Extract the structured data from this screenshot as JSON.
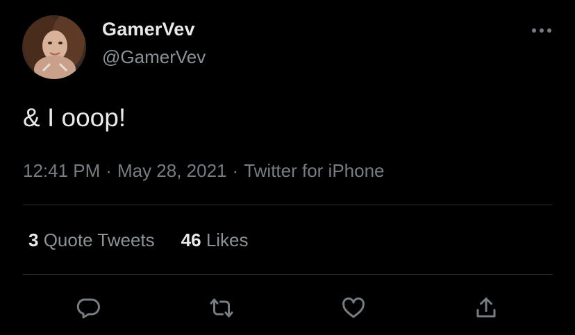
{
  "author": {
    "display_name": "GamerVev",
    "handle": "@GamerVev"
  },
  "tweet": {
    "text": "& I ooop!",
    "time": "12:41 PM",
    "date": "May 28, 2021",
    "source": "Twitter for iPhone",
    "separator": "·"
  },
  "stats": {
    "quote_tweets_count": "3",
    "quote_tweets_label": "Quote Tweets",
    "likes_count": "46",
    "likes_label": "Likes"
  },
  "icons": {
    "more": "more-horizontal-icon",
    "reply": "reply-bubble-icon",
    "retweet": "retweet-icon",
    "like": "heart-icon",
    "share": "share-icon"
  },
  "colors": {
    "background": "#000000",
    "primary_text": "#e7e9ea",
    "secondary_text": "#8b9298",
    "divider": "#2f3336"
  }
}
